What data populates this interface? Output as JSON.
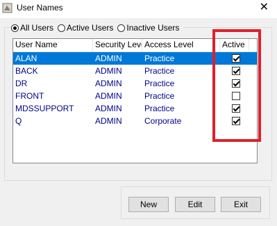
{
  "window": {
    "title": "User Names",
    "close_glyph": "✕"
  },
  "filter": {
    "options": [
      {
        "label": "All Users",
        "checked": true
      },
      {
        "label": "Active Users",
        "checked": false
      },
      {
        "label": "Inactive Users",
        "checked": false
      }
    ]
  },
  "table": {
    "columns": [
      "User Name",
      "Security Level",
      "Access Level",
      "Active"
    ],
    "rows": [
      {
        "user": "ALAN",
        "security": "ADMIN",
        "access": "Practice",
        "active": true,
        "selected": true
      },
      {
        "user": "BACK",
        "security": "ADMIN",
        "access": "Practice",
        "active": true,
        "selected": false
      },
      {
        "user": "DR",
        "security": "ADMIN",
        "access": "Practice",
        "active": true,
        "selected": false
      },
      {
        "user": "FRONT",
        "security": "ADMIN",
        "access": "Practice",
        "active": false,
        "selected": false
      },
      {
        "user": "MDSSUPPORT",
        "security": "ADMIN",
        "access": "Practice",
        "active": true,
        "selected": false
      },
      {
        "user": "Q",
        "security": "ADMIN",
        "access": "Corporate",
        "active": true,
        "selected": false
      }
    ]
  },
  "buttons": {
    "new": "New",
    "edit": "Edit",
    "exit": "Exit"
  },
  "colors": {
    "selection": "#0078d7",
    "row_text": "#00008b",
    "highlight": "#e0202a"
  },
  "icons": {
    "app": "app-icon",
    "close": "close-icon"
  }
}
